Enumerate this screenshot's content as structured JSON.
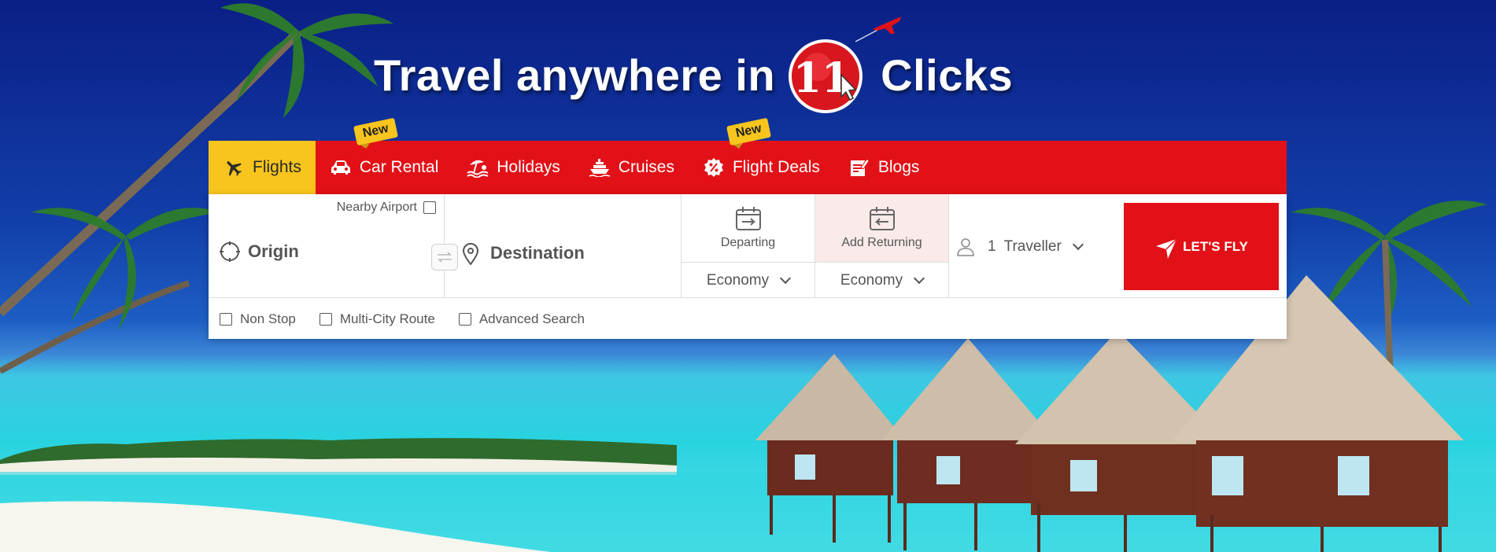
{
  "headline": {
    "left_text": "Travel anywhere in",
    "logo_number": "11",
    "right_text": "Clicks"
  },
  "tabs": [
    {
      "label": "Flights",
      "icon": "plane-icon",
      "active": true,
      "badge": ""
    },
    {
      "label": "Car Rental",
      "icon": "car-icon",
      "active": false,
      "badge": "New"
    },
    {
      "label": "Holidays",
      "icon": "beach-umbrella-icon",
      "active": false,
      "badge": ""
    },
    {
      "label": "Cruises",
      "icon": "ship-icon",
      "active": false,
      "badge": ""
    },
    {
      "label": "Flight Deals",
      "icon": "percent-tag-icon",
      "active": false,
      "badge": "New"
    },
    {
      "label": "Blogs",
      "icon": "notepad-icon",
      "active": false,
      "badge": ""
    }
  ],
  "form": {
    "nearby_airport_label": "Nearby Airport",
    "origin_placeholder": "Origin",
    "destination_placeholder": "Destination",
    "departing_label": "Departing",
    "returning_label": "Add Returning",
    "depart_cabin": "Economy",
    "return_cabin": "Economy",
    "traveller_count": "1",
    "traveller_label": "Traveller",
    "submit_label": "LET'S FLY",
    "options": [
      "Non Stop",
      "Multi-City Route",
      "Advanced Search"
    ]
  },
  "colors": {
    "brand_red": "#e21118",
    "active_tab_yellow": "#f7c51d",
    "text_gray": "#555555"
  }
}
